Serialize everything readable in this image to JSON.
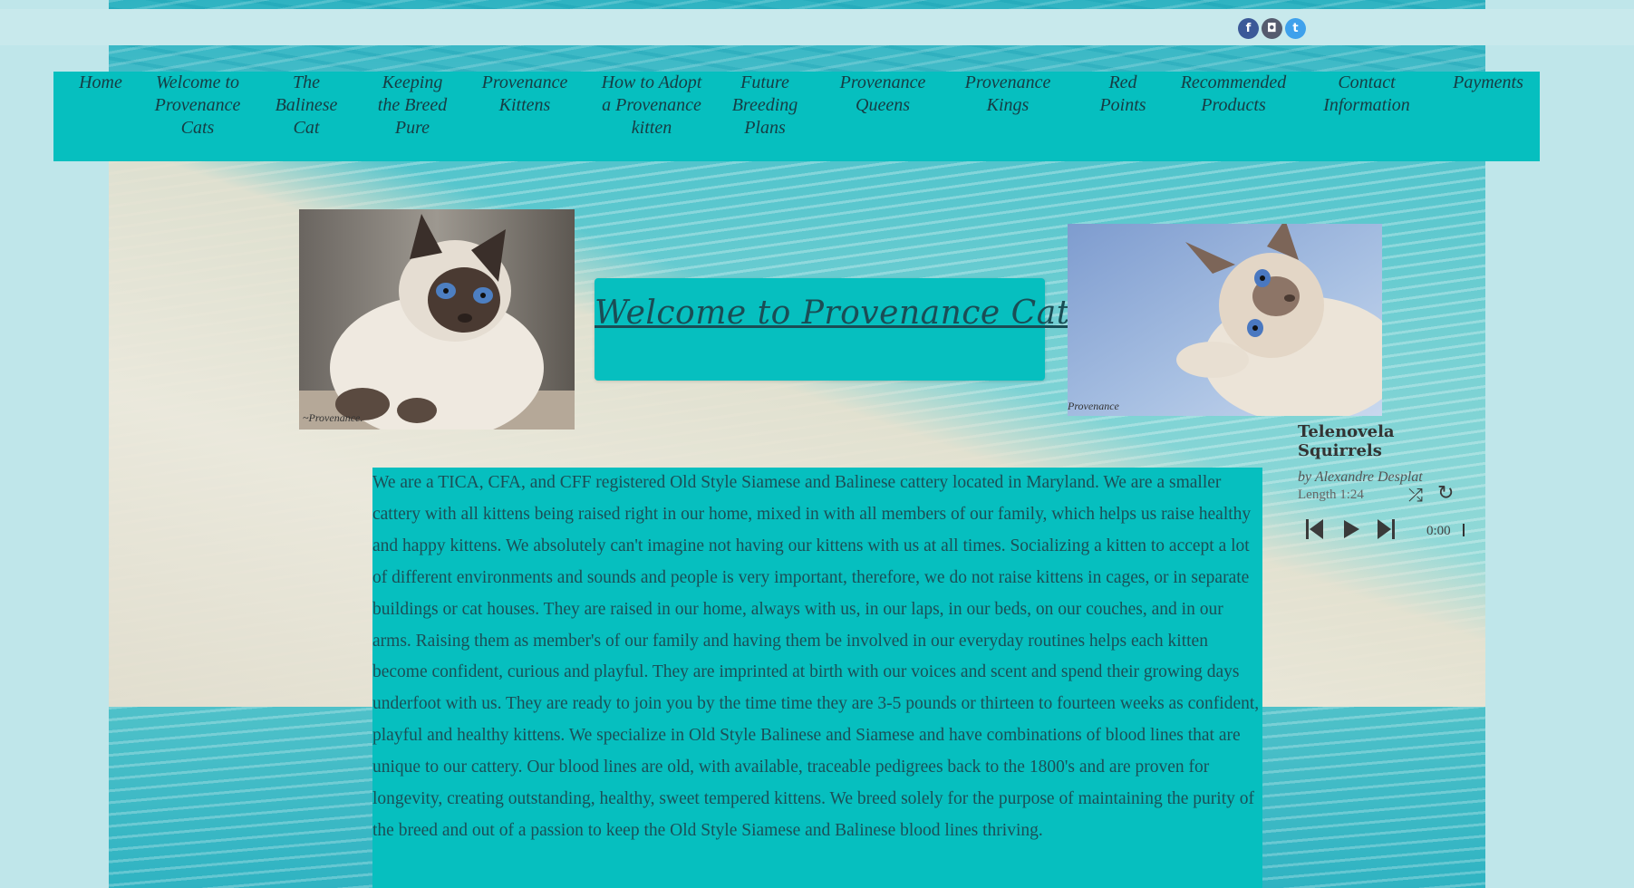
{
  "social": {
    "facebook_icon": "f",
    "instagram_icon": "◘",
    "twitter_icon": "t"
  },
  "nav": {
    "items": [
      {
        "label": "Home"
      },
      {
        "label": "Welcome to Provenance Cats"
      },
      {
        "label": "The Balinese Cat"
      },
      {
        "label": "Keeping the Breed Pure"
      },
      {
        "label": "Provenance Kittens"
      },
      {
        "label": "How to Adopt a Provenance kitten"
      },
      {
        "label": "Future Breeding Plans"
      },
      {
        "label": "Provenance Queens"
      },
      {
        "label": "Provenance Kings"
      },
      {
        "label": "Red Points"
      },
      {
        "label": "Recommended Products"
      },
      {
        "label": "Contact Information"
      },
      {
        "label": "Payments"
      }
    ]
  },
  "photos": {
    "left_caption": "~Provenance.",
    "right_caption": "Provenance"
  },
  "welcome": {
    "title": "Welcome to Provenance Cats"
  },
  "body": {
    "text": "We are a TICA, CFA, and CFF registered Old Style Siamese and Balinese cattery located in Maryland.  We are a smaller cattery with all kittens being raised right in our home, mixed in with all members of our family, which helps us raise healthy and happy kittens. We absolutely can't imagine not having our kittens with us at all times. Socializing a kitten to accept a lot of different environments and sounds and people is very important, therefore, we do not raise kittens in cages, or in separate buildings or cat houses.  They are raised in our home, always with us, in our laps, in our beds, on our couches, and in our arms.  Raising them as member's of our family and having them be involved in our everyday routines helps each kitten become confident, curious and playful. They are imprinted at birth with our voices and scent and spend their growing days underfoot with us. They are ready to join you by the time time they are 3-5 pounds or thirteen to fourteen weeks as confident, playful and healthy kittens.  We specialize in Old Style Balinese and Siamese and have combinations of blood lines that are unique to our cattery.   Our blood lines are old, with available, traceable pedigrees back to the 1800's and are proven for longevity, creating outstanding, healthy, sweet tempered kittens.  We breed solely for the purpose of maintaining the purity of the breed and out of a passion to keep the Old Style Siamese and Balinese blood lines thriving."
  },
  "player": {
    "title": "Telenovela Squirrels",
    "artist": "by Alexandre Desplat",
    "length": "Length 1:24",
    "time": "0:00",
    "progress": 0
  }
}
